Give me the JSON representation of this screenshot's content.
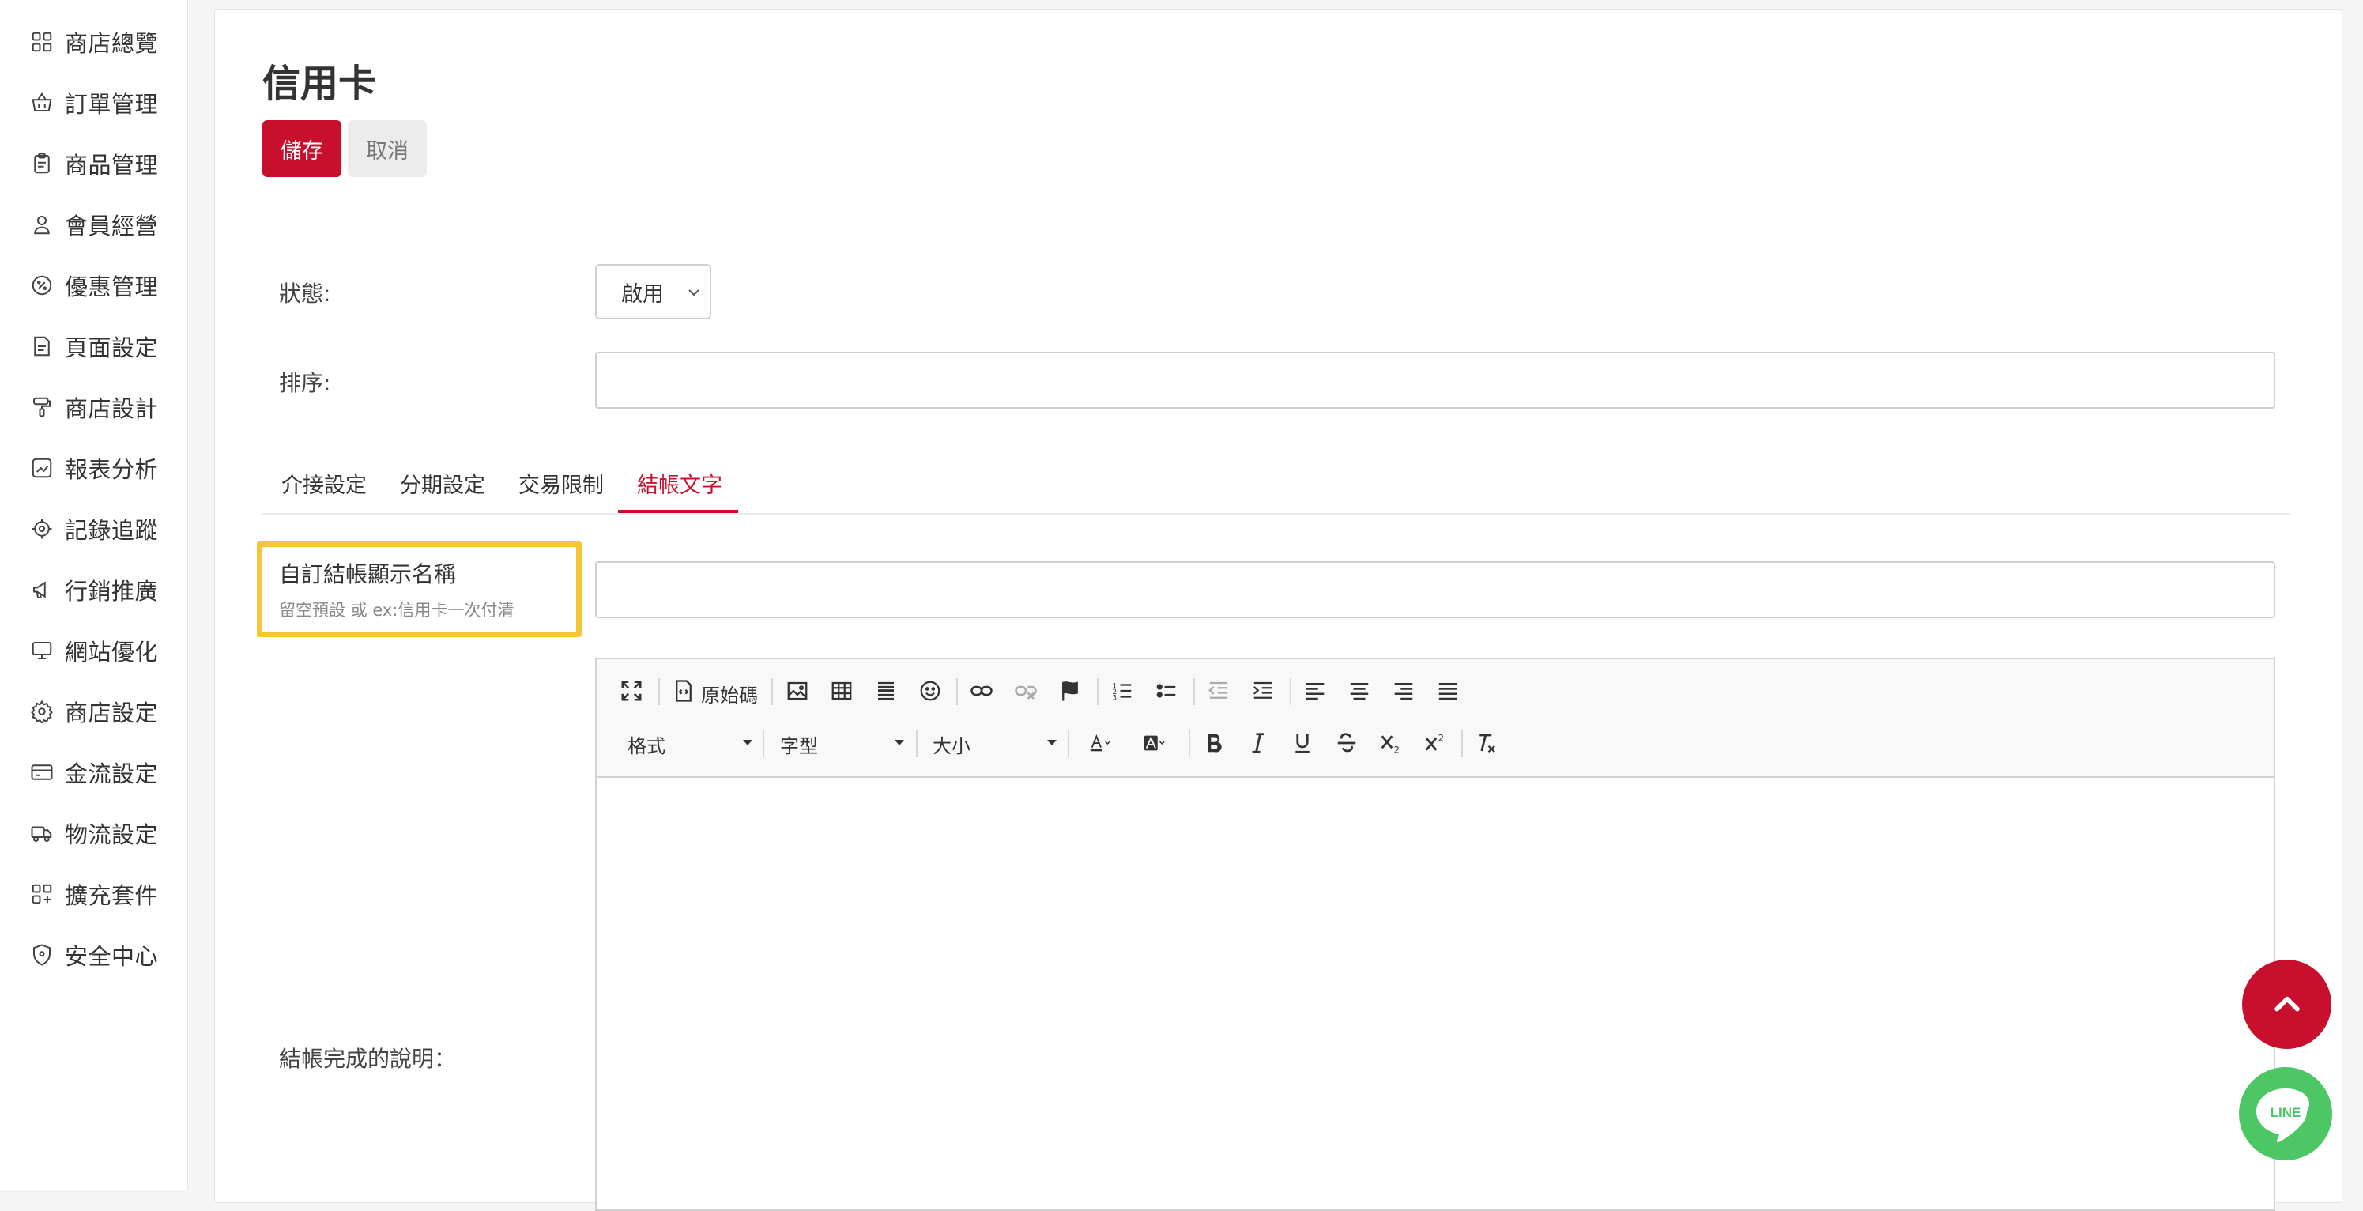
{
  "sidebar": {
    "items": [
      {
        "label": "商店總覽",
        "icon": "grid-icon"
      },
      {
        "label": "訂單管理",
        "icon": "basket-icon"
      },
      {
        "label": "商品管理",
        "icon": "clipboard-icon"
      },
      {
        "label": "會員經營",
        "icon": "user-icon"
      },
      {
        "label": "優惠管理",
        "icon": "discount-badge-icon"
      },
      {
        "label": "頁面設定",
        "icon": "page-icon"
      },
      {
        "label": "商店設計",
        "icon": "paint-roller-icon"
      },
      {
        "label": "報表分析",
        "icon": "chart-icon"
      },
      {
        "label": "記錄追蹤",
        "icon": "target-icon"
      },
      {
        "label": "行銷推廣",
        "icon": "megaphone-icon"
      },
      {
        "label": "網站優化",
        "icon": "monitor-icon"
      },
      {
        "label": "商店設定",
        "icon": "gear-icon"
      },
      {
        "label": "金流設定",
        "icon": "credit-card-icon"
      },
      {
        "label": "物流設定",
        "icon": "truck-icon"
      },
      {
        "label": "擴充套件",
        "icon": "plugin-icon"
      },
      {
        "label": "安全中心",
        "icon": "shield-icon"
      }
    ]
  },
  "page": {
    "title": "信用卡",
    "save_label": "儲存",
    "cancel_label": "取消"
  },
  "form": {
    "status_label": "狀態:",
    "status_value": "啟用",
    "sort_label": "排序:",
    "sort_value": ""
  },
  "tabs": [
    {
      "label": "介接設定",
      "active": false
    },
    {
      "label": "分期設定",
      "active": false
    },
    {
      "label": "交易限制",
      "active": false
    },
    {
      "label": "結帳文字",
      "active": true
    }
  ],
  "checkout_text": {
    "display_name_label": "自訂結帳顯示名稱",
    "display_name_hint": "留空預設 或 ex:信用卡一次付清",
    "display_name_value": "",
    "completion_label": "結帳完成的說明："
  },
  "editor": {
    "source_label": "原始碼",
    "format_label": "格式",
    "font_label": "字型",
    "size_label": "大小"
  },
  "floating": {
    "line_label": "LINE"
  },
  "colors": {
    "accent": "#c8102e",
    "highlight": "#f7c637",
    "line_green": "#4cc764"
  }
}
